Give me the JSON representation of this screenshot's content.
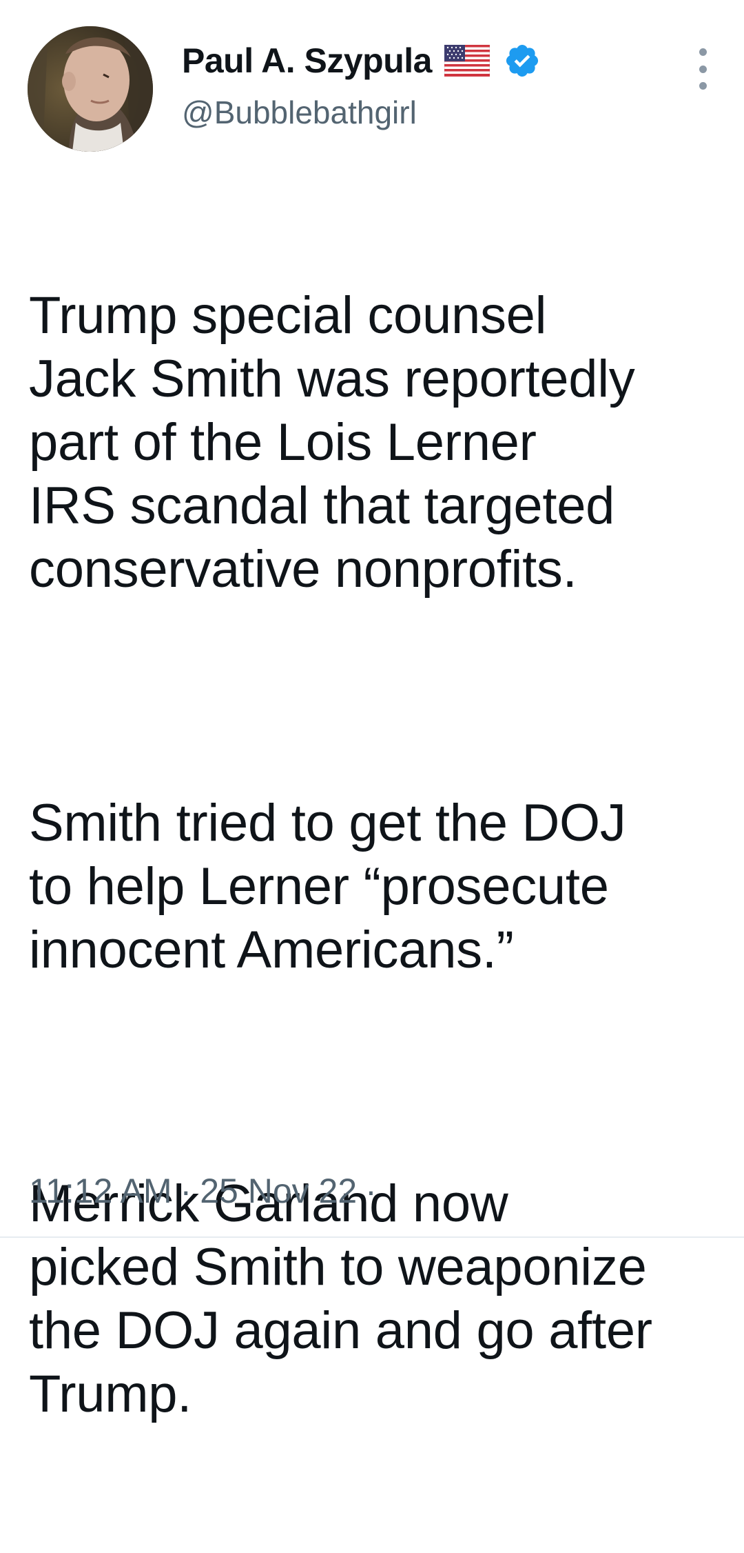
{
  "tweet": {
    "author": {
      "display_name": "Paul A. Szypula",
      "handle": "@Bubblebathgirl",
      "badges": [
        "us-flag-icon",
        "verified-icon"
      ],
      "avatar": "avatar"
    },
    "paragraphs": [
      "Trump special counsel\nJack Smith was reportedly\npart of the Lois Lerner\nIRS scandal that targeted\nconservative nonprofits.",
      "Smith tried to get the DOJ\nto help Lerner “prosecute\ninnocent Americans.”",
      "Merrick Garland now\npicked Smith to weaponize\nthe DOJ again and go after\nTrump."
    ],
    "time": "11:12 AM",
    "date": "25 Nov 22",
    "separator": "·",
    "more_icon": "more-vertical-icon"
  },
  "colors": {
    "text": "#0f1419",
    "secondary_text": "#536471",
    "verified_blue": "#1d9bf0",
    "more_dots": "#8b98a5"
  }
}
